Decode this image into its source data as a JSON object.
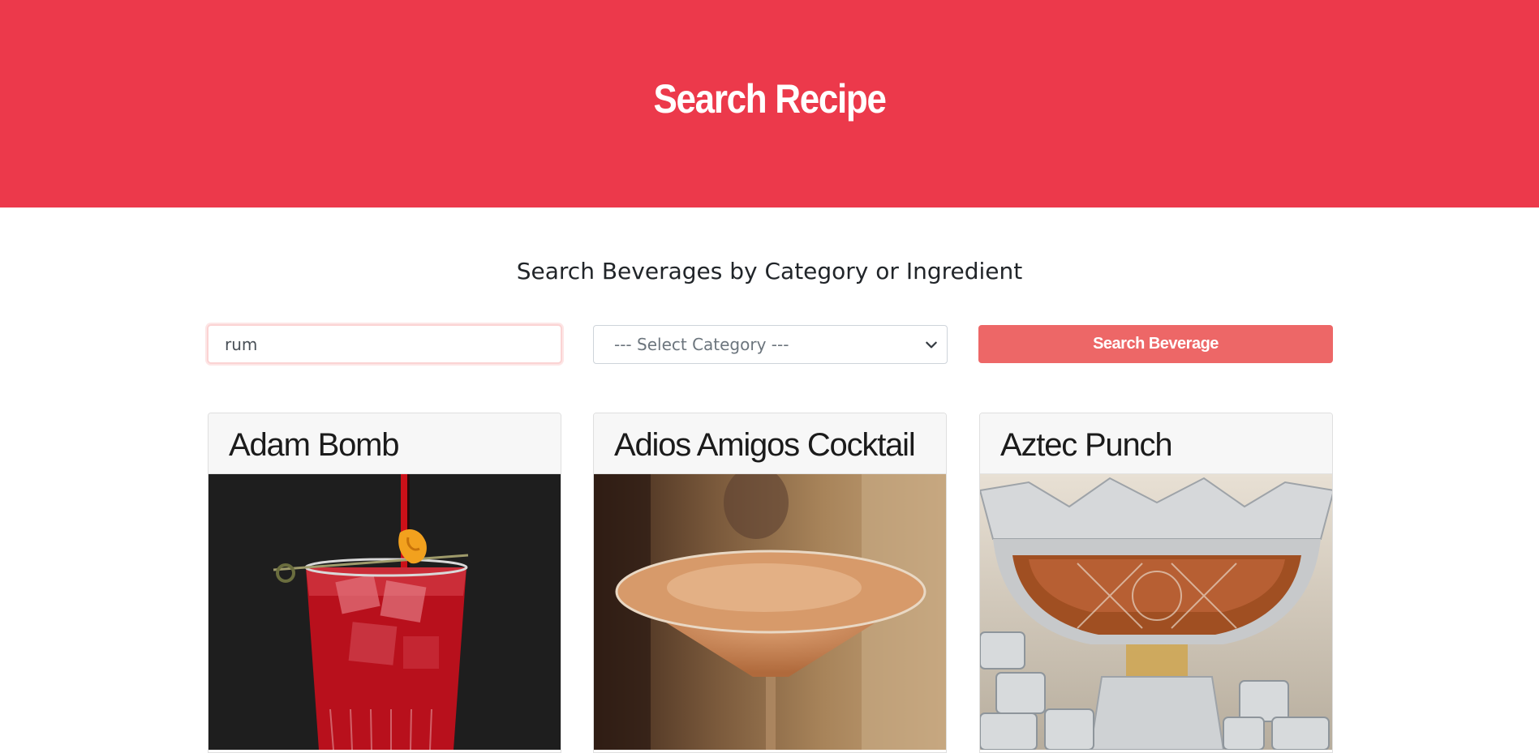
{
  "header": {
    "title": "Search Recipe",
    "background_color": "#ec394b"
  },
  "search": {
    "subtitle": "Search Beverages by Category or Ingredient",
    "input_value": "rum",
    "category_placeholder": "--- Select Category ---",
    "button_label": "Search Beverage",
    "button_color": "#ed6767"
  },
  "results": [
    {
      "name": "Adam Bomb",
      "image_icon": "red-cocktail-glass-image"
    },
    {
      "name": "Adios Amigos Cocktail",
      "image_icon": "martini-glass-image"
    },
    {
      "name": "Aztec Punch",
      "image_icon": "punch-bowl-image"
    }
  ]
}
